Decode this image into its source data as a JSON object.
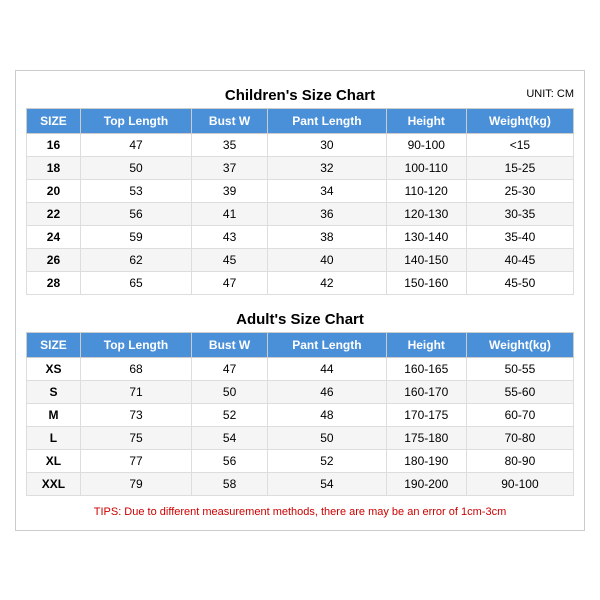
{
  "children_chart": {
    "title": "Children's Size Chart",
    "unit": "UNIT: CM",
    "headers": [
      "SIZE",
      "Top Length",
      "Bust W",
      "Pant Length",
      "Height",
      "Weight(kg)"
    ],
    "rows": [
      [
        "16",
        "47",
        "35",
        "30",
        "90-100",
        "<15"
      ],
      [
        "18",
        "50",
        "37",
        "32",
        "100-110",
        "15-25"
      ],
      [
        "20",
        "53",
        "39",
        "34",
        "110-120",
        "25-30"
      ],
      [
        "22",
        "56",
        "41",
        "36",
        "120-130",
        "30-35"
      ],
      [
        "24",
        "59",
        "43",
        "38",
        "130-140",
        "35-40"
      ],
      [
        "26",
        "62",
        "45",
        "40",
        "140-150",
        "40-45"
      ],
      [
        "28",
        "65",
        "47",
        "42",
        "150-160",
        "45-50"
      ]
    ]
  },
  "adults_chart": {
    "title": "Adult's Size Chart",
    "headers": [
      "SIZE",
      "Top Length",
      "Bust W",
      "Pant Length",
      "Height",
      "Weight(kg)"
    ],
    "rows": [
      [
        "XS",
        "68",
        "47",
        "44",
        "160-165",
        "50-55"
      ],
      [
        "S",
        "71",
        "50",
        "46",
        "160-170",
        "55-60"
      ],
      [
        "M",
        "73",
        "52",
        "48",
        "170-175",
        "60-70"
      ],
      [
        "L",
        "75",
        "54",
        "50",
        "175-180",
        "70-80"
      ],
      [
        "XL",
        "77",
        "56",
        "52",
        "180-190",
        "80-90"
      ],
      [
        "XXL",
        "79",
        "58",
        "54",
        "190-200",
        "90-100"
      ]
    ]
  },
  "tips": "TIPS: Due to different measurement methods, there are may be an error of 1cm-3cm"
}
